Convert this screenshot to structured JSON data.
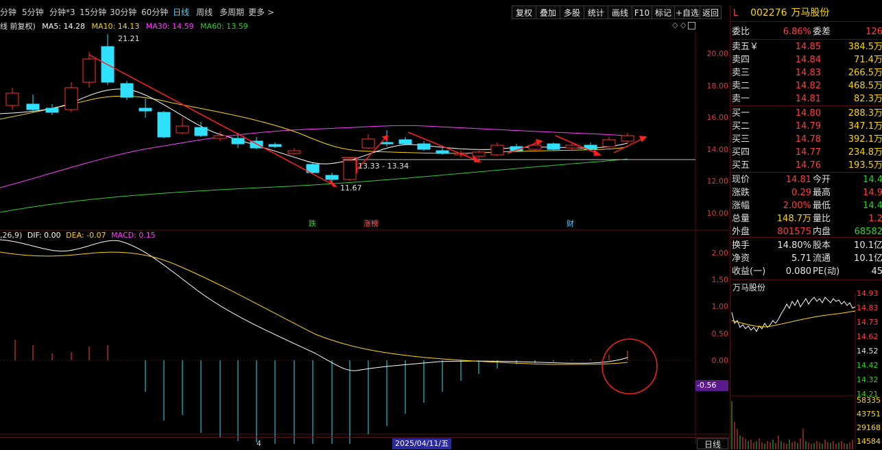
{
  "toolbar": {
    "periods": [
      "分钟",
      "5分钟",
      "分钟*3",
      "15分钟",
      "30分钟",
      "60分钟",
      "日线",
      "周线",
      "多周期",
      "更多 >"
    ],
    "active_period": "日线",
    "tools": [
      "复权",
      "叠加",
      "多股",
      "统计",
      "画线",
      "F10",
      "标记",
      "+自选",
      "返回"
    ]
  },
  "legend": {
    "prefix": "线 前复权)",
    "ma5": "MA5: 14.28",
    "ma10": "MA10: 14.13",
    "ma30": "MA30: 14.59",
    "ma60": "MA60: 13.59",
    "colors": {
      "ma5": "#ffffff",
      "ma10": "#ffd700",
      "ma30": "#ff40ff",
      "ma60": "#30d030"
    }
  },
  "price_axis": [
    "20.00",
    "18.00",
    "16.00",
    "14.00",
    "12.00",
    "10.00"
  ],
  "annotations": {
    "high": "21.21",
    "low": "11.67",
    "range": "13.33 - 13.34"
  },
  "event_marks": [
    "跌",
    "涨榜",
    "财"
  ],
  "macd_legend": {
    "prefix": ",26,9)",
    "dif": "DIF: 0.00",
    "dea": "DEA: -0.07",
    "macd": "MACD: 0.15"
  },
  "macd_axis": [
    "2.00",
    "1.50",
    "1.00",
    "0.50",
    "0.00"
  ],
  "macd_value_tag": "-0.56",
  "date_bar": {
    "date": "2025/04/11/五",
    "mark": "4",
    "period_button": "日线"
  },
  "stock": {
    "header_prefix": "L",
    "code": "002276",
    "name": "万马股份"
  },
  "order_book": {
    "wei_bi_label": "委比",
    "wei_bi": "6.86%",
    "wei_cha_label": "委差",
    "wei_cha": "126",
    "sells": [
      {
        "label": "卖五￥",
        "price": "14.85",
        "vol": "384.5万"
      },
      {
        "label": "卖四",
        "price": "14.84",
        "vol": "71.4万"
      },
      {
        "label": "卖三",
        "price": "14.83",
        "vol": "266.5万"
      },
      {
        "label": "卖二",
        "price": "14.82",
        "vol": "468.5万"
      },
      {
        "label": "卖一",
        "price": "14.81",
        "vol": "82.3万"
      }
    ],
    "buys": [
      {
        "label": "买一",
        "price": "14.80",
        "vol": "288.3万"
      },
      {
        "label": "买二",
        "price": "14.79",
        "vol": "347.1万"
      },
      {
        "label": "买三",
        "price": "14.78",
        "vol": "392.1万"
      },
      {
        "label": "买四",
        "price": "14.77",
        "vol": "234.8万"
      },
      {
        "label": "买五",
        "price": "14.76",
        "vol": "193.5万"
      }
    ]
  },
  "stats": [
    {
      "l1": "现价",
      "v1": "14.81",
      "c1": "red",
      "l2": "今开",
      "v2": "14.4",
      "c2": "green"
    },
    {
      "l1": "涨跌",
      "v1": "0.29",
      "c1": "red",
      "l2": "最高",
      "v2": "14.9",
      "c2": "red"
    },
    {
      "l1": "涨幅",
      "v1": "2.00%",
      "c1": "red",
      "l2": "最低",
      "v2": "14.4",
      "c2": "green"
    },
    {
      "l1": "总量",
      "v1": "148.7万",
      "c1": "yellow",
      "l2": "量比",
      "v2": "1.2",
      "c2": "red"
    },
    {
      "l1": "外盘",
      "v1": "801575",
      "c1": "red",
      "l2": "内盘",
      "v2": "68582",
      "c2": "green"
    },
    {
      "l1": "换手",
      "v1": "14.80%",
      "c1": "white",
      "l2": "股本",
      "v2": "10.1亿",
      "c2": "white"
    },
    {
      "l1": "净资",
      "v1": "5.71",
      "c1": "white",
      "l2": "流通",
      "v2": "10.1亿",
      "c2": "white"
    },
    {
      "l1": "收益(一)",
      "v1": "0.080",
      "c1": "white",
      "l2": "PE(动)",
      "v2": "45",
      "c2": "white"
    }
  ],
  "mini_chart": {
    "title": "万马股份",
    "axis": [
      "14.93",
      "14.83",
      "14.73",
      "14.62",
      "14.52",
      "14.42",
      "14.32",
      "14.21"
    ],
    "axis_colors": [
      "red",
      "red",
      "red",
      "red",
      "white",
      "green",
      "green",
      "green"
    ],
    "vol_axis": [
      "58335",
      "43751",
      "29168",
      "14584"
    ]
  }
}
